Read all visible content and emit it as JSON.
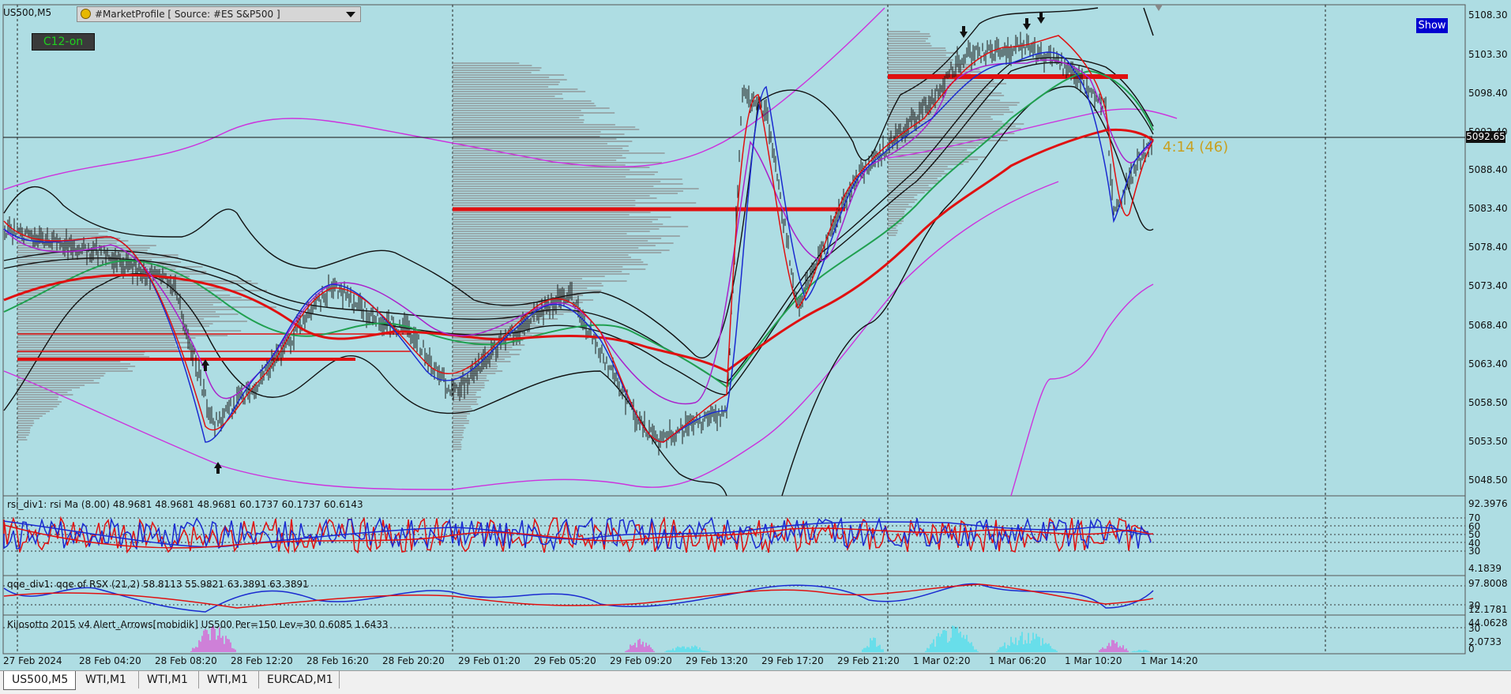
{
  "window": {
    "symbol_label": "US500,M5",
    "indicator_header": "#MarketProfile [ Source: #ES S&P500 ]",
    "c12_button": "C12-on",
    "show_button": "Show",
    "timer_label": "4:14 (46)",
    "current_price": "5092.65"
  },
  "price_axis": [
    "5108.30",
    "5103.30",
    "5098.40",
    "5092.40",
    "5088.40",
    "5083.40",
    "5078.40",
    "5073.40",
    "5068.40",
    "5063.40",
    "5058.50",
    "5053.50",
    "5048.50"
  ],
  "time_axis": [
    "27 Feb 2024",
    "28 Feb 04:20",
    "28 Feb 08:20",
    "28 Feb 12:20",
    "28 Feb 16:20",
    "28 Feb 20:20",
    "29 Feb 01:20",
    "29 Feb 05:20",
    "29 Feb 09:20",
    "29 Feb 13:20",
    "29 Feb 17:20",
    "29 Feb 21:20",
    "1 Mar 02:20",
    "1 Mar 06:20",
    "1 Mar 10:20",
    "1 Mar 14:20"
  ],
  "rsi_pane": {
    "label": "rsi_div1: rsi Ma (8.00) 48.9681 48.9681 48.9681 60.1737 60.1737 60.6143",
    "scale": [
      "92.3976",
      "70",
      "60",
      "50",
      "40",
      "30",
      "4.1839"
    ]
  },
  "qqe_pane": {
    "label": "qqe_div1: qqe of RSX (21,2) 58.8113 55.9821 63.3891 63.3891",
    "scale": [
      "97.8008",
      "30",
      "12.1781"
    ]
  },
  "kiss_pane": {
    "label": "Kijosotto 2015 v4 Alert_Arrows[mobidik] US500 Per=150 Lev=30 0.6085 1.6433",
    "scale": [
      "44.0628",
      "30",
      "2.0733",
      "0"
    ]
  },
  "tabs": [
    {
      "label": "US500,M5",
      "active": true
    },
    {
      "label": "WTI,M1",
      "active": false
    },
    {
      "label": "WTI,M1",
      "active": false
    },
    {
      "label": "WTI,M1",
      "active": false
    },
    {
      "label": "EURCAD,M1",
      "active": false
    }
  ],
  "colors": {
    "chart_bg": "#aedde3",
    "price_line": "#000000",
    "ma_red": "#e01010",
    "ma_green": "#20a050",
    "ma_blue": "#1a2ad0",
    "band_magenta": "#cc33dd",
    "profile_gray": "#8a8a8a",
    "histogram_cyan": "#22e0f0",
    "histogram_magenta": "#ee22cc"
  }
}
